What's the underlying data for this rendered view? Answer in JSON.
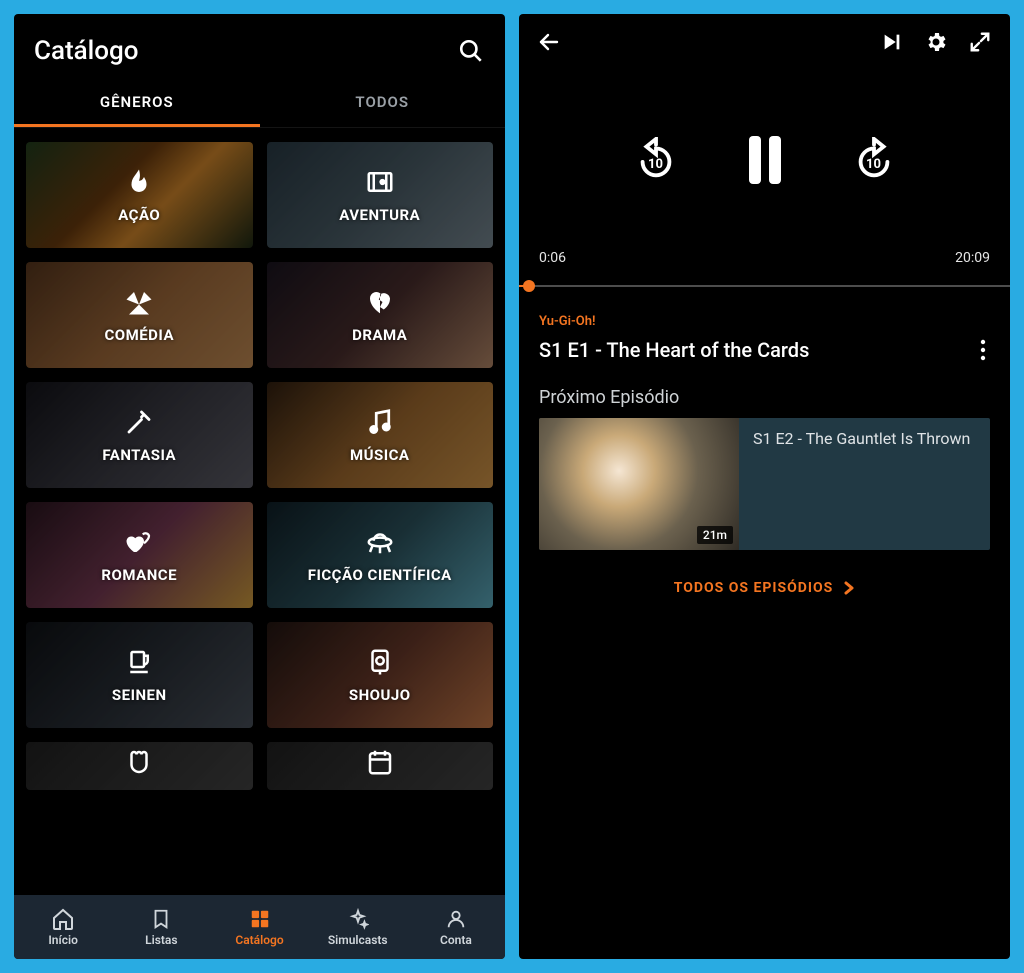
{
  "left": {
    "title": "Catálogo",
    "tabs": {
      "genres": "GÊNEROS",
      "all": "TODOS"
    },
    "genres": [
      {
        "label": "AÇÃO",
        "icon": "flame",
        "bg": "bg-acao"
      },
      {
        "label": "AVENTURA",
        "icon": "map",
        "bg": "bg-avent"
      },
      {
        "label": "COMÉDIA",
        "icon": "fan",
        "bg": "bg-comedia"
      },
      {
        "label": "DRAMA",
        "icon": "heartbreak",
        "bg": "bg-drama"
      },
      {
        "label": "FANTASIA",
        "icon": "sword",
        "bg": "bg-fant"
      },
      {
        "label": "MÚSICA",
        "icon": "music",
        "bg": "bg-musica"
      },
      {
        "label": "ROMANCE",
        "icon": "hearts",
        "bg": "bg-romance"
      },
      {
        "label": "FICÇÃO CIENTÍFICA",
        "icon": "ufo",
        "bg": "bg-sci"
      },
      {
        "label": "SEINEN",
        "icon": "cup",
        "bg": "bg-seinen"
      },
      {
        "label": "SHOUJO",
        "icon": "flower",
        "bg": "bg-shoujo"
      }
    ],
    "genres_overflow": [
      {
        "label": "",
        "icon": "fist",
        "bg": "bg-generic"
      },
      {
        "label": "",
        "icon": "calendar",
        "bg": "bg-generic"
      }
    ],
    "nav": [
      {
        "label": "Início",
        "icon": "home"
      },
      {
        "label": "Listas",
        "icon": "bookmark"
      },
      {
        "label": "Catálogo",
        "icon": "grid",
        "active": true
      },
      {
        "label": "Simulcasts",
        "icon": "sparkle"
      },
      {
        "label": "Conta",
        "icon": "account"
      }
    ]
  },
  "right": {
    "time_current": "0:06",
    "time_total": "20:09",
    "seek_seconds": "10",
    "series": "Yu-Gi-Oh!",
    "episode_title": "S1 E1 - The Heart of the Cards",
    "next_heading": "Próximo Episódio",
    "next": {
      "title": "S1 E2 - The Gauntlet Is Thrown",
      "duration": "21m"
    },
    "all_episodes": "TODOS OS EPISÓDIOS"
  }
}
